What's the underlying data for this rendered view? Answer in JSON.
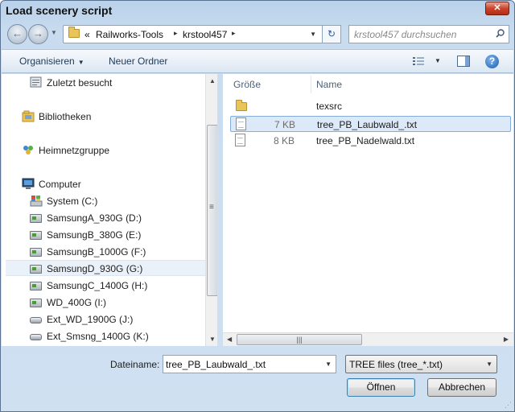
{
  "window": {
    "title": "Load scenery script",
    "close_label": "✕"
  },
  "nav": {
    "back_glyph": "←",
    "forward_glyph": "→",
    "breadcrumb_overflow": "«",
    "breadcrumbs": [
      "Railworks-Tools",
      "krstool457"
    ],
    "refresh_glyph": "↻",
    "search_placeholder": "krstool457 durchsuchen"
  },
  "toolbar": {
    "organize_label": "Organisieren",
    "new_folder_label": "Neuer Ordner",
    "help_label": "?"
  },
  "sidebar": {
    "items": [
      {
        "label": "Zuletzt besucht",
        "icon": "recent-places-icon"
      },
      {
        "label": "Bibliotheken",
        "icon": "libraries-icon"
      },
      {
        "label": "Heimnetzgruppe",
        "icon": "homegroup-icon"
      },
      {
        "label": "Computer",
        "icon": "computer-icon"
      },
      {
        "label": "System (C:)",
        "icon": "system-drive-icon"
      },
      {
        "label": "SamsungA_930G (D:)",
        "icon": "drive-icon"
      },
      {
        "label": "SamsungB_380G (E:)",
        "icon": "drive-icon"
      },
      {
        "label": "SamsungB_1000G (F:)",
        "icon": "drive-icon"
      },
      {
        "label": "SamsungD_930G (G:)",
        "icon": "drive-icon",
        "selected": true
      },
      {
        "label": "SamsungC_1400G (H:)",
        "icon": "drive-icon"
      },
      {
        "label": "WD_400G (I:)",
        "icon": "drive-icon"
      },
      {
        "label": "Ext_WD_1900G (J:)",
        "icon": "external-drive-icon"
      },
      {
        "label": "Ext_Smsng_1400G (K:)",
        "icon": "external-drive-icon"
      }
    ]
  },
  "files": {
    "columns": {
      "size": "Größe",
      "name": "Name"
    },
    "rows": [
      {
        "size": "",
        "name": "texsrc",
        "type": "folder"
      },
      {
        "size": "7 KB",
        "name": "tree_PB_Laubwald_.txt",
        "type": "text",
        "selected": true
      },
      {
        "size": "8 KB",
        "name": "tree_PB_Nadelwald.txt",
        "type": "text"
      }
    ]
  },
  "footer": {
    "filename_label": "Dateiname:",
    "filename_value": "tree_PB_Laubwald_.txt",
    "filetype_value": "TREE files (tree_*.txt)",
    "open_label": "Öffnen",
    "cancel_label": "Abbrechen"
  },
  "colors": {
    "accent": "#3c7fb1",
    "selection": "#dce9f8",
    "chrome": "#c9dcef"
  }
}
